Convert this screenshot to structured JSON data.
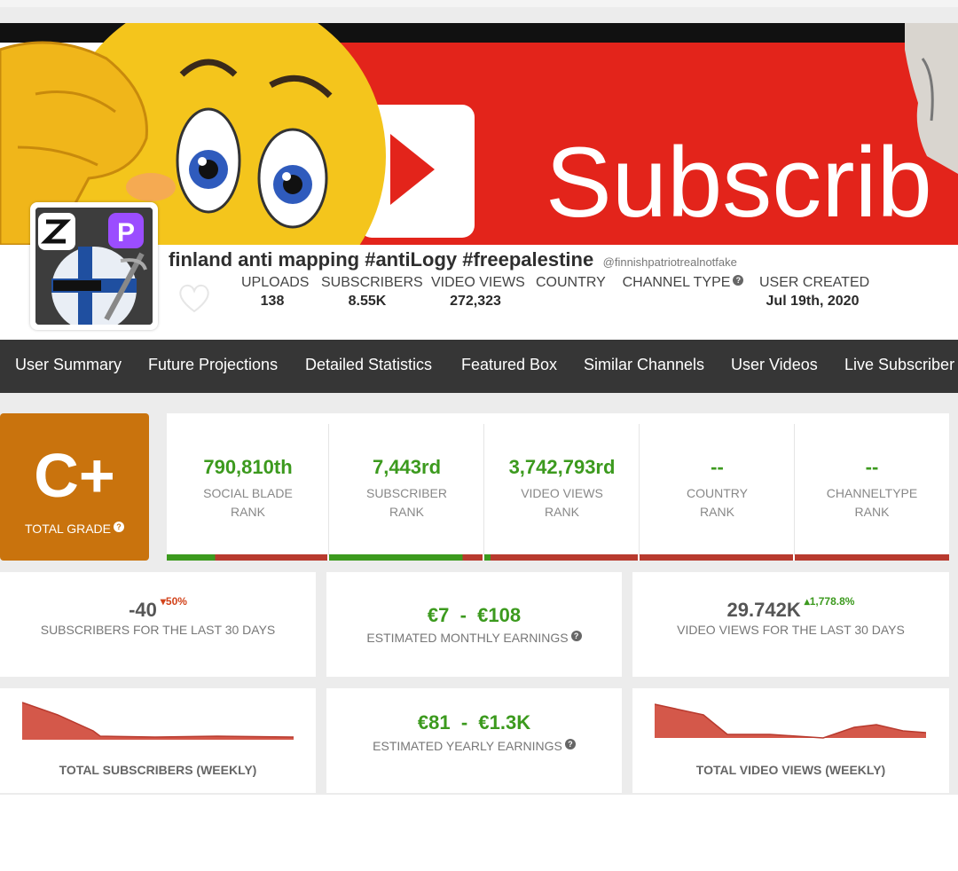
{
  "banner": {
    "text": "Subscrib"
  },
  "channel": {
    "name": "finland anti mapping #antiLogy #freepalestine",
    "handle": "@finnishpatriotrealnotfake"
  },
  "stats": [
    {
      "label": "UPLOADS",
      "value": "138"
    },
    {
      "label": "SUBSCRIBERS",
      "value": "8.55K"
    },
    {
      "label": "VIDEO VIEWS",
      "value": "272,323"
    },
    {
      "label": "COUNTRY",
      "value": ""
    },
    {
      "label": "CHANNEL TYPE",
      "value": ""
    },
    {
      "label": "USER CREATED",
      "value": "Jul 19th, 2020"
    }
  ],
  "nav": [
    "User Summary",
    "Future Projections",
    "Detailed Statistics",
    "Featured Box",
    "Similar Channels",
    "User Videos",
    "Live Subscriber C"
  ],
  "grade": {
    "letter": "C+",
    "label": "TOTAL GRADE"
  },
  "ranks": [
    {
      "value": "790,810th",
      "line1": "SOCIAL BLADE",
      "line2": "RANK",
      "bar_green_fraction": 0.3
    },
    {
      "value": "7,443rd",
      "line1": "SUBSCRIBER",
      "line2": "RANK",
      "bar_green_fraction": 0.87
    },
    {
      "value": "3,742,793rd",
      "line1": "VIDEO VIEWS",
      "line2": "RANK",
      "bar_green_fraction": 0.04
    },
    {
      "value": "--",
      "line1": "COUNTRY",
      "line2": "RANK",
      "bar_green_fraction": 0
    },
    {
      "value": "--",
      "line1": "CHANNELTYPE",
      "line2": "RANK",
      "bar_green_fraction": 0
    }
  ],
  "cards": {
    "subs30": {
      "value": "-40",
      "delta": "50%",
      "label": "SUBSCRIBERS FOR THE LAST 30 DAYS"
    },
    "monthly": {
      "value": "€7  -  €108",
      "label": "ESTIMATED MONTHLY EARNINGS"
    },
    "views30": {
      "value": "29.742K",
      "delta": "1,778.8%",
      "label": "VIDEO VIEWS FOR THE LAST 30 DAYS"
    },
    "subsWeekly": {
      "label": "TOTAL SUBSCRIBERS (WEEKLY)"
    },
    "yearly": {
      "value": "€81  -  €1.3K",
      "label": "ESTIMATED YEARLY EARNINGS"
    },
    "viewsWeekly": {
      "label": "TOTAL VIDEO VIEWS (WEEKLY)"
    }
  },
  "colors": {
    "grade": "#c9730d",
    "green": "#3c9a1e",
    "red": "#b83a2e",
    "chart": "#d4584a",
    "nav": "#363636"
  }
}
